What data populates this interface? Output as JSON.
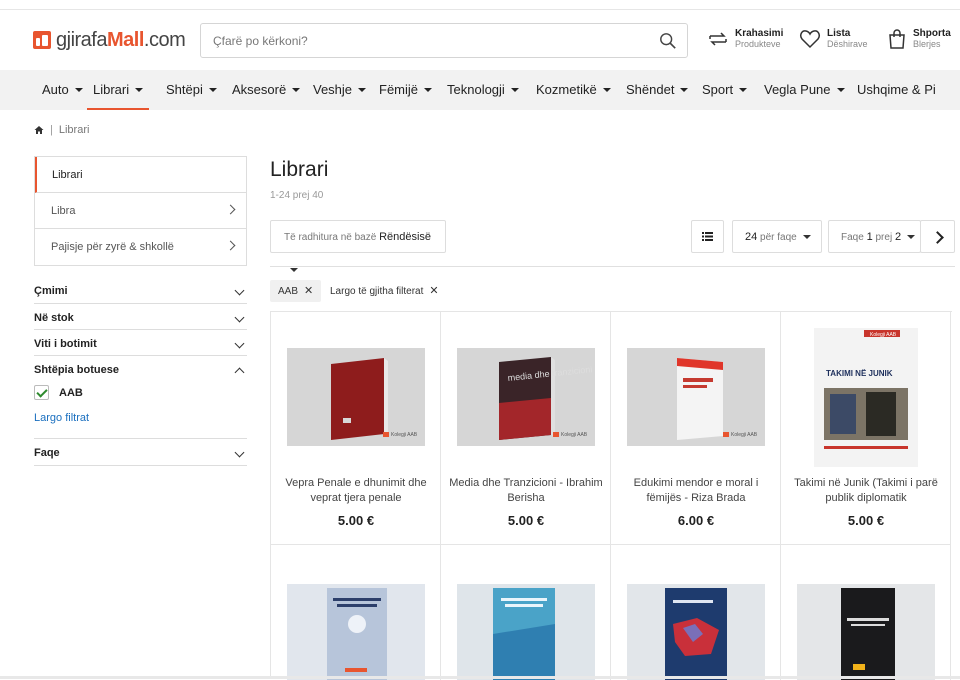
{
  "brand": {
    "name_part1": "gjirafa",
    "name_part2": "Mall",
    "name_part3": ".com",
    "accent": "#e8552f"
  },
  "search": {
    "placeholder": "Çfarë po kërkoni?"
  },
  "header_actions": [
    {
      "title": "Krahasimi",
      "subtitle": "Produkteve",
      "icon": "compare-icon"
    },
    {
      "title": "Lista",
      "subtitle": "Dëshirave",
      "icon": "heart-icon"
    },
    {
      "title": "Shporta",
      "subtitle": "Blerjes",
      "icon": "shopping-bag-icon"
    }
  ],
  "nav": [
    "Auto",
    "Librari",
    "Shtëpi",
    "Aksesorë",
    "Veshje",
    "Fëmijë",
    "Teknologji",
    "Kozmetikë",
    "Shëndet",
    "Sport",
    "Vegla Pune",
    "Ushqime & Pi"
  ],
  "nav_active": "Librari",
  "breadcrumb": {
    "current": "Librari",
    "home_icon": "home-icon"
  },
  "categories": {
    "head": "Librari",
    "items": [
      "Libra",
      "Pajisje për zyrë & shkollë"
    ]
  },
  "filters": {
    "price": "Çmimi",
    "stock": "Në stok",
    "year": "Viti i botimit",
    "publisher": "Shtëpia botuese",
    "publisher_option": "AAB",
    "clear": "Largo filtrat",
    "pages": "Faqe"
  },
  "listing": {
    "title": "Librari",
    "count": "1-24 prej 40"
  },
  "sort": {
    "prefix": "Të radhitura në bazë",
    "value": "Rëndësisë"
  },
  "per_page": {
    "value": "24",
    "suffix": "për faqe"
  },
  "pagination": {
    "prefix": "Faqe",
    "current": "1",
    "middle": "prej",
    "total": "2"
  },
  "active_filters": {
    "tag": "AAB",
    "clear_all": "Largo të gjitha filterat"
  },
  "products": [
    {
      "title": "Vepra Penale e dhunimit dhe veprat tjera penale",
      "price": "5.00 €"
    },
    {
      "title": "Media dhe Tranzicioni - Ibrahim Berisha",
      "price": "5.00 €"
    },
    {
      "title": "Edukimi mendor e moral i fëmijës - Riza Brada",
      "price": "6.00 €"
    },
    {
      "title": "Takimi në Junik (Takimi i parë publik diplomatik",
      "price": "5.00 €"
    }
  ],
  "product_covers": [
    {
      "publisher_mark": "Kolegji AAB",
      "cover_text": ""
    },
    {
      "publisher_mark": "Kolegji AAB",
      "cover_text": "media dhe tranzicioni"
    },
    {
      "publisher_mark": "Kolegji AAB",
      "cover_text": ""
    },
    {
      "publisher_mark": "Kolegji AAB",
      "cover_text": "TAKIMI NË JUNIK"
    }
  ]
}
